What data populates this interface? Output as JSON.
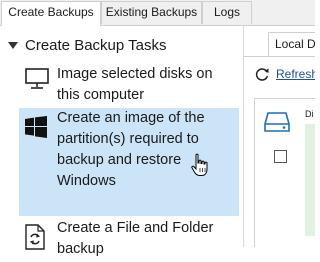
{
  "tabs": [
    {
      "label": "Create Backups",
      "active": true
    },
    {
      "label": "Existing Backups",
      "active": false
    },
    {
      "label": "Logs",
      "active": false
    }
  ],
  "tree": {
    "header": "Create Backup Tasks",
    "items": [
      {
        "label": "Image selected disks on\nthis computer",
        "icon": "monitor-icon"
      },
      {
        "label": "Create an image of the\npartition(s) required to\nbackup and restore\nWindows",
        "icon": "windows-logo-icon",
        "selected": true
      },
      {
        "label": "Create a File and Folder\nbackup",
        "icon": "file-sync-icon"
      }
    ]
  },
  "right_pane": {
    "tab_label": "Local Dis",
    "refresh_label": "Refresh",
    "disk_label": "Di"
  },
  "colors": {
    "selection": "#cce4f7",
    "link": "#1f4e9c",
    "accent_icon": "#1e6fb8"
  }
}
